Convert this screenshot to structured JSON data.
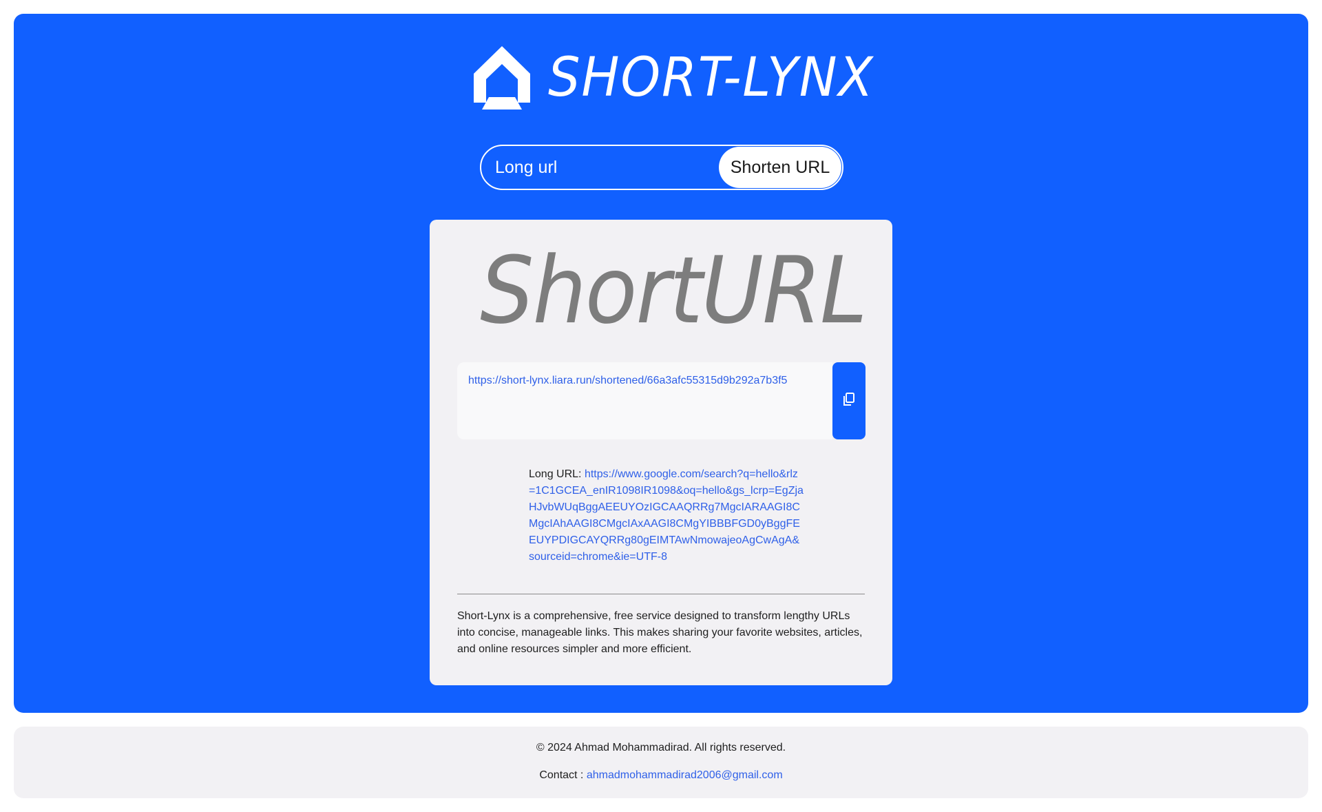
{
  "brand": {
    "name": "SHORT-LYNX",
    "logo_icon": "shortlynx-logo-icon"
  },
  "search": {
    "placeholder": "Long url",
    "value": "",
    "button_label": "Shorten URL"
  },
  "result": {
    "title": "ShortURL",
    "short_url": "https://short-lynx.liara.run/shortened/66a3afc55315d9b292a7b3f5",
    "copy_icon": "copy-icon",
    "long_url_label": "Long URL: ",
    "long_url": "https://www.google.com/search?q=hello&rlz=1C1GCEA_enIR1098IR1098&oq=hello&gs_lcrp=EgZjaHJvbWUqBggAEEUYOzIGCAAQRRg7MgcIARAAGI8CMgcIAhAAGI8CMgcIAxAAGI8CMgYIBBBFGD0yBggFEEUYPDIGCAYQRRg80gEIMTAwNmowajeoAgCwAgA&sourceid=chrome&ie=UTF-8",
    "description": "Short-Lynx is a comprehensive, free service designed to transform lengthy URLs into concise, manageable links. This makes sharing your favorite websites, articles, and online resources simpler and more efficient."
  },
  "footer": {
    "copyright": "© 2024 Ahmad Mohammadirad. All rights reserved.",
    "contact_label": "Contact : ",
    "contact_email": "ahmadmohammadirad2006@gmail.com"
  },
  "colors": {
    "accent": "#1160ff",
    "card_bg": "#f2f1f4",
    "link": "#2f60e8"
  }
}
